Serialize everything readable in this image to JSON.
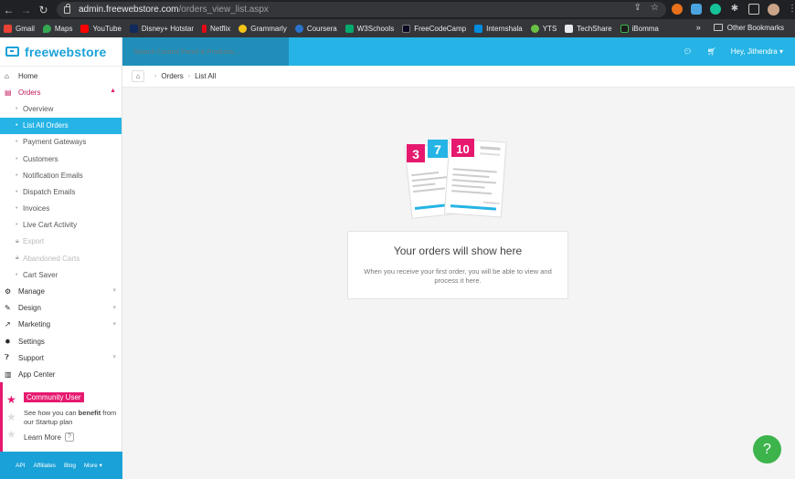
{
  "browser": {
    "url_host": "admin.freewebstore.com",
    "url_path": "/orders_view_list.aspx"
  },
  "bookmarks": {
    "items": [
      "Gmail",
      "Maps",
      "YouTube",
      "Disney+ Hotstar",
      "Netflix",
      "Grammarly",
      "Coursera",
      "W3Schools",
      "FreeCodeCamp",
      "Internshala",
      "YTS",
      "TechShare",
      "iBomma"
    ],
    "overflow": "»",
    "other": "Other Bookmarks"
  },
  "logo": {
    "text": "freewebstore"
  },
  "search": {
    "placeholder": "Search Control Panel & Products..."
  },
  "header": {
    "user": "Hey, Jithendra ▾"
  },
  "breadcrumb": {
    "orders": "Orders",
    "current": "List All"
  },
  "menu": {
    "home": "Home",
    "orders": "Orders",
    "orders_sub": [
      "Overview",
      "List All Orders",
      "Payment Gateways",
      "Customers",
      "Notification Emails",
      "Dispatch Emails",
      "Invoices",
      "Live Cart Activity",
      "Export",
      "Abandoned Carts",
      "Cart Saver"
    ],
    "manage": "Manage",
    "design": "Design",
    "marketing": "Marketing",
    "settings": "Settings",
    "support": "Support",
    "app_center": "App Center"
  },
  "community": {
    "badge": "Community User",
    "text_pre": "See how you can ",
    "text_bold": "benefit",
    "text_post": " from our Startup plan",
    "learn": "Learn More",
    "q": "?"
  },
  "footer": {
    "api": "API",
    "affiliates": "Affiliates",
    "blog": "Blog",
    "more": "More ▾"
  },
  "empty": {
    "title": "Your orders will show here",
    "body": "When you receive your first order, you will be able to view and process it here.",
    "numbers": [
      "3",
      "7",
      "10"
    ],
    "illus_caption": "freewebstore"
  },
  "help": {
    "label": "?"
  },
  "colors": {
    "accent": "#25b4e5",
    "pink": "#e6196f",
    "green": "#3cb44b"
  }
}
